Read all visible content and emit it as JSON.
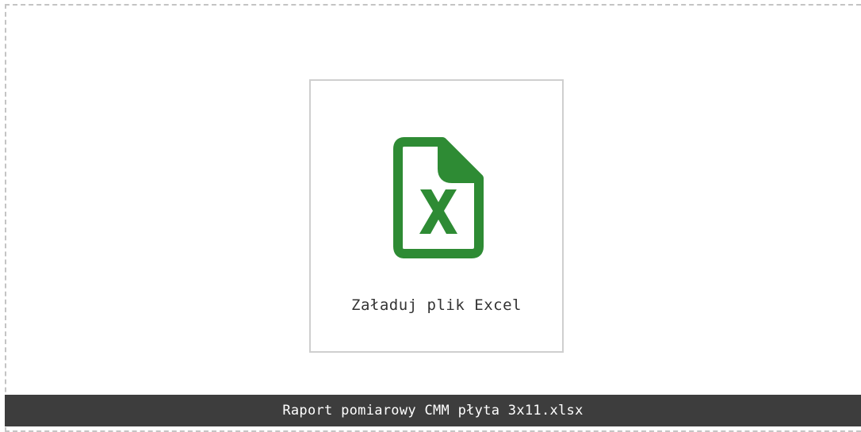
{
  "upload": {
    "label": "Załaduj plik Excel",
    "icon": "excel-file-icon",
    "icon_letter": "X",
    "icon_color": "#2e8b34"
  },
  "file_bar": {
    "file_name": "Raport pomiarowy CMM płyta 3x11.xlsx",
    "background": "#3d3d3d"
  }
}
